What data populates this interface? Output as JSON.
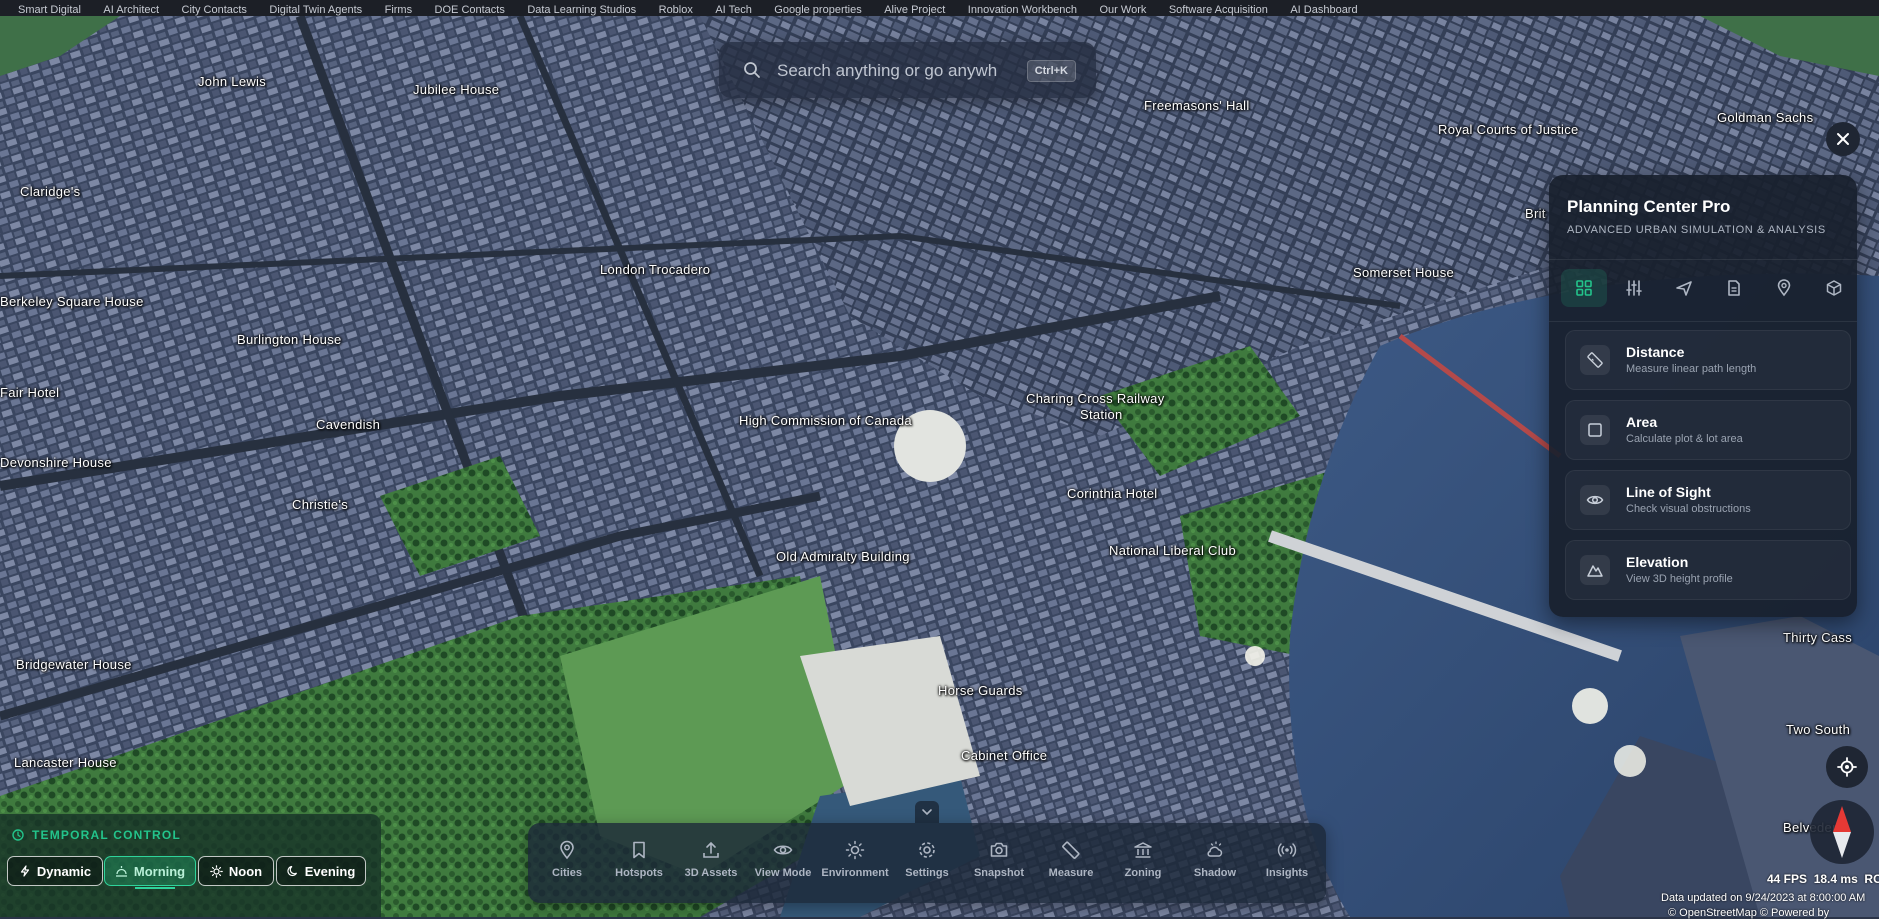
{
  "browser": {
    "bookmarks": [
      "Smart Digital",
      "AI Architect",
      "City Contacts",
      "Digital Twin Agents",
      "Firms",
      "DOE Contacts",
      "Data Learning Studios",
      "Roblox",
      "AI Tech",
      "Google properties",
      "Alive Project",
      "Innovation Workbench",
      "Our Work",
      "Software Acquisition",
      "AI Dashboard"
    ]
  },
  "search": {
    "placeholder": "Search anything or go anywhere",
    "shortcut": "Ctrl+K"
  },
  "map_labels": [
    "John Lewis",
    "Jubilee House",
    "Freemasons' Hall",
    "Royal Courts of Justice",
    "Goldman Sachs",
    "Claridge's",
    "London Trocadero",
    "Somerset House",
    "Berkeley Square House",
    "Burlington House",
    "Fair Hotel",
    "Cavendish",
    "High Commission of Canada",
    "Charing Cross Railway",
    "Station",
    "Devonshire House",
    "Christie's",
    "Corinthia Hotel",
    "Old Admiralty Building",
    "National Liberal Club",
    "Bridgewater House",
    "Horse Guards",
    "Lancaster House",
    "Cabinet Office",
    "Thirty Cass",
    "Two South",
    "Belvedere",
    "Brit"
  ],
  "panel": {
    "title": "Planning Center Pro",
    "subtitle": "ADVANCED URBAN SIMULATION & ANALYSIS",
    "tabs": [
      "dashboard-icon",
      "sliders-icon",
      "plane-icon",
      "document-icon",
      "map-pin-icon",
      "cube-icon"
    ],
    "tools": [
      {
        "title": "Distance",
        "desc": "Measure linear path length",
        "icon": "ruler-icon"
      },
      {
        "title": "Area",
        "desc": "Calculate plot & lot area",
        "icon": "square-icon"
      },
      {
        "title": "Line of Sight",
        "desc": "Check visual obstructions",
        "icon": "eye-icon"
      },
      {
        "title": "Elevation",
        "desc": "View 3D height profile",
        "icon": "mountain-icon"
      }
    ]
  },
  "temporal": {
    "title": "TEMPORAL CONTROL",
    "buttons": [
      {
        "label": "Dynamic",
        "icon": "bolt-icon"
      },
      {
        "label": "Morning",
        "icon": "sunrise-icon",
        "active": true
      },
      {
        "label": "Noon",
        "icon": "sun-icon"
      },
      {
        "label": "Evening",
        "icon": "moon-icon"
      }
    ]
  },
  "dock": {
    "items": [
      {
        "label": "Cities",
        "icon": "map-pin-icon"
      },
      {
        "label": "Hotspots",
        "icon": "bookmark-icon"
      },
      {
        "label": "3D Assets",
        "icon": "upload-icon"
      },
      {
        "label": "View Mode",
        "icon": "eye-icon"
      },
      {
        "label": "Environment",
        "icon": "sun-icon"
      },
      {
        "label": "Settings",
        "icon": "gear-icon"
      },
      {
        "label": "Snapshot",
        "icon": "camera-icon"
      },
      {
        "label": "Measure",
        "icon": "ruler-icon"
      },
      {
        "label": "Zoning",
        "icon": "landmark-icon"
      },
      {
        "label": "Shadow",
        "icon": "cloud-sun-icon"
      },
      {
        "label": "Insights",
        "icon": "broadcast-icon"
      }
    ]
  },
  "stats": {
    "fps": "44 FPS",
    "ms": "18.4 ms",
    "suffix": "RC",
    "data_updated": "Data updated on 9/24/2023 at 8:00:00 AM",
    "attribution": "© OpenStreetMap © Powered by"
  },
  "colors": {
    "accent": "#23c48b",
    "panel_bg": "#18202c",
    "compass_red": "#e53935"
  }
}
